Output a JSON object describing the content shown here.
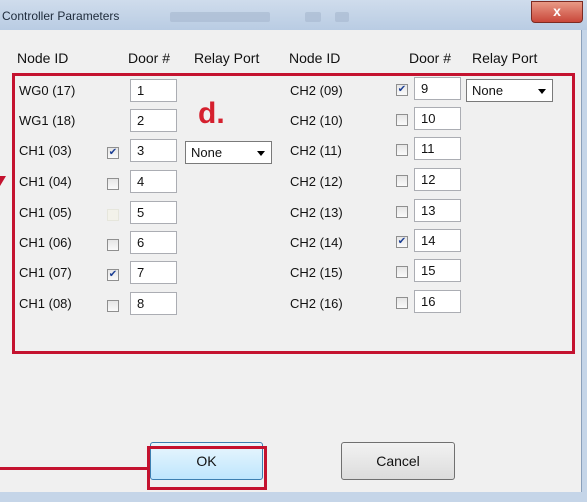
{
  "window": {
    "title": "Controller Parameters",
    "close_glyph": "x"
  },
  "headers": {
    "left": {
      "node_id": "Node ID",
      "door": "Door #",
      "relay": "Relay Port"
    },
    "right": {
      "node_id": "Node ID",
      "door": "Door #",
      "relay": "Relay Port"
    }
  },
  "left_rows": [
    {
      "node": "WG0 (17)",
      "has_checkbox": false,
      "checked": false,
      "door": "1"
    },
    {
      "node": "WG1 (18)",
      "has_checkbox": false,
      "checked": false,
      "door": "2"
    },
    {
      "node": "CH1 (03)",
      "has_checkbox": true,
      "checked": true,
      "door": "3",
      "relay": "None"
    },
    {
      "node": "CH1 (04)",
      "has_checkbox": true,
      "checked": false,
      "door": "4"
    },
    {
      "node": "CH1 (05)",
      "has_checkbox": true,
      "checked": false,
      "door": "5"
    },
    {
      "node": "CH1 (06)",
      "has_checkbox": true,
      "checked": false,
      "door": "6"
    },
    {
      "node": "CH1 (07)",
      "has_checkbox": true,
      "checked": true,
      "door": "7"
    },
    {
      "node": "CH1 (08)",
      "has_checkbox": true,
      "checked": false,
      "door": "8"
    }
  ],
  "right_rows": [
    {
      "node": "CH2 (09)",
      "checked": true,
      "door": "9",
      "relay": "None"
    },
    {
      "node": "CH2 (10)",
      "checked": false,
      "door": "10"
    },
    {
      "node": "CH2 (11)",
      "checked": false,
      "door": "11"
    },
    {
      "node": "CH2 (12)",
      "checked": false,
      "door": "12"
    },
    {
      "node": "CH2 (13)",
      "checked": false,
      "door": "13"
    },
    {
      "node": "CH2 (14)",
      "checked": true,
      "door": "14"
    },
    {
      "node": "CH2 (15)",
      "checked": false,
      "door": "15"
    },
    {
      "node": "CH2 (16)",
      "checked": false,
      "door": "16"
    }
  ],
  "annotation": "d.",
  "buttons": {
    "ok": "OK",
    "cancel": "Cancel"
  },
  "colors": {
    "highlight": "#c4122f",
    "check": "#1c3f94"
  },
  "icons": {
    "checkmark": "check-icon",
    "dropdown": "chevron-down-icon",
    "close": "close-icon"
  }
}
